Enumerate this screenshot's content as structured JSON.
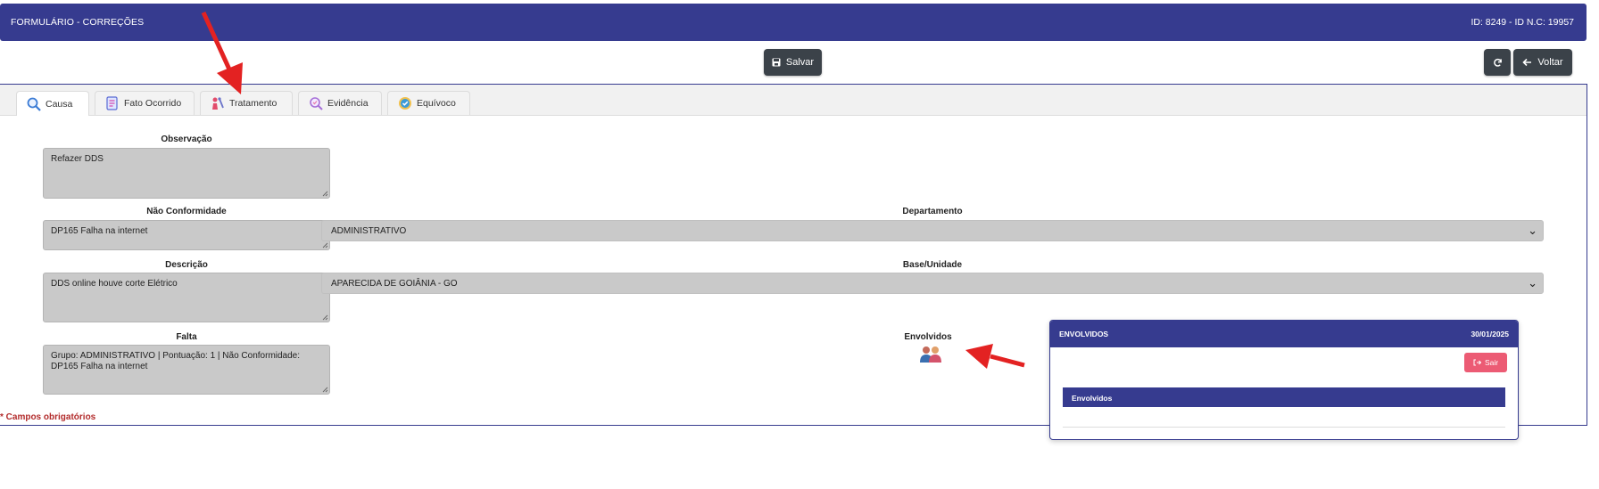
{
  "header": {
    "title": "FORMULÁRIO - CORREÇÕES",
    "ids": "ID: 8249 - ID N.C: 19957"
  },
  "toolbar": {
    "save_label": "Salvar",
    "back_label": "Voltar",
    "refresh_icon": "refresh-icon",
    "save_icon": "floppy-disk-icon",
    "back_icon": "arrow-left-icon"
  },
  "tabs": [
    {
      "label": "Causa",
      "icon": "magnifier-icon",
      "active": true
    },
    {
      "label": "Fato Ocorrido",
      "icon": "report-icon",
      "active": false
    },
    {
      "label": "Tratamento",
      "icon": "treatment-icon",
      "active": false
    },
    {
      "label": "Evidência",
      "icon": "evidence-icon",
      "active": false
    },
    {
      "label": "Equívoco",
      "icon": "check-badge-icon",
      "active": false
    }
  ],
  "form": {
    "observacao_label": "Observação",
    "observacao_value": "Refazer DDS",
    "nao_conformidade_label": "Não Conformidade",
    "nao_conformidade_value": "DP165 Falha na internet",
    "departamento_label": "Departamento",
    "departamento_value": "ADMINISTRATIVO",
    "descricao_label": "Descrição",
    "descricao_value": "DDS online houve corte Elétrico",
    "base_label": "Base/Unidade",
    "base_value": "APARECIDA DE GOIÂNIA - GO",
    "falta_label": "Falta",
    "falta_value": "Grupo: ADMINISTRATIVO | Pontuação: 1 | Não Conformidade: DP165 Falha na internet",
    "envolvidos_label": "Envolvidos",
    "required_note": "* Campos obrigatórios"
  },
  "modal": {
    "title": "ENVOLVIDOS",
    "date": "30/01/2025",
    "exit_label": "Sair",
    "table_header": "Envolvidos"
  },
  "colors": {
    "primary": "#363b8f",
    "field_bg": "#c9c9c9",
    "button_dark": "#3b4249",
    "danger": "#ec5b74",
    "annotation": "#e32222",
    "required": "#b22b2b"
  }
}
